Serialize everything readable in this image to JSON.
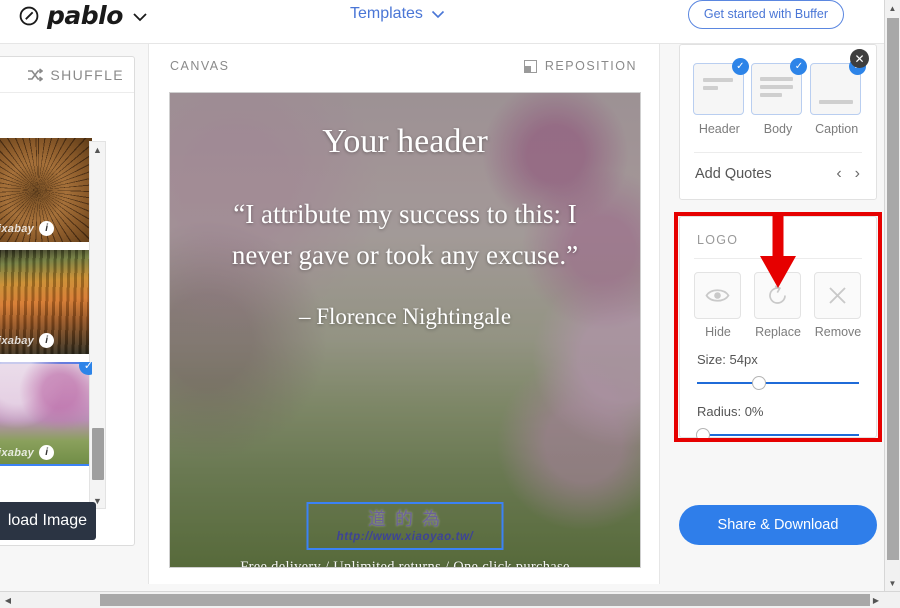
{
  "topbar": {
    "brand": "pablo",
    "brand_icon": "circle-slash-icon",
    "brand_caret_icon": "chevron-down-icon",
    "templates_label": "Templates",
    "templates_caret_icon": "chevron-down-icon",
    "buffer_button": "Get started with Buffer",
    "accent_blue": "#4a76d6"
  },
  "left_panel": {
    "shuffle_label": "SHUFFLE",
    "shuffle_icon": "shuffle-icon",
    "close_icon": "close-icon",
    "upload_button": "load Image",
    "upload_button_full": "Upload Image",
    "thumbnails": [
      {
        "name": "tree-rings-photo",
        "watermark": "pixabay",
        "info_icon": "info-icon",
        "selected": false
      },
      {
        "name": "autumn-forest-photo",
        "watermark": "pixabay",
        "info_icon": "info-icon",
        "selected": false
      },
      {
        "name": "cherry-blossom-photo",
        "watermark": "pixabay",
        "info_icon": "info-icon",
        "selected": true
      }
    ],
    "scroll_up_icon": "triangle-up-icon",
    "scroll_down_icon": "triangle-down-icon"
  },
  "canvas": {
    "label": "CANVAS",
    "reposition_label": "REPOSITION",
    "reposition_icon": "reposition-icon",
    "header_text": "Your header",
    "quote_text": "“I attribute my success to this: I never gave or took any excuse.”",
    "author_text": "– Florence Nightingale",
    "logo_cjk": "道 的 為",
    "logo_url": "http://www.xiaoyao.tw/",
    "footer_text": "Free delivery / Unlimited returns / One click purchase",
    "selection_color": "#3b82f6"
  },
  "right_panel": {
    "types": [
      {
        "label": "Header",
        "checked": true,
        "check_icon": "check-icon"
      },
      {
        "label": "Body",
        "checked": true,
        "check_icon": "check-icon"
      },
      {
        "label": "Caption",
        "checked": true,
        "check_icon": "check-icon"
      }
    ],
    "quotes_label": "Add Quotes",
    "quotes_prev_icon": "chevron-left-icon",
    "quotes_next_icon": "chevron-right-icon",
    "logo": {
      "title": "LOGO",
      "actions": [
        {
          "label": "Hide",
          "icon": "eye-icon"
        },
        {
          "label": "Replace",
          "icon": "refresh-icon"
        },
        {
          "label": "Remove",
          "icon": "close-x-icon"
        }
      ],
      "size_label": "Size: 54px",
      "size_percent": 38,
      "radius_label": "Radius: 0%",
      "radius_percent": 0
    },
    "share_button": "Share & Download",
    "highlight_color": "#e60000",
    "arrow_icon": "down-arrow-annotation"
  },
  "scrollbars": {
    "v_up_icon": "triangle-up-icon",
    "v_down_icon": "triangle-down-icon",
    "h_left_icon": "triangle-left-icon",
    "h_right_icon": "triangle-right-icon"
  }
}
